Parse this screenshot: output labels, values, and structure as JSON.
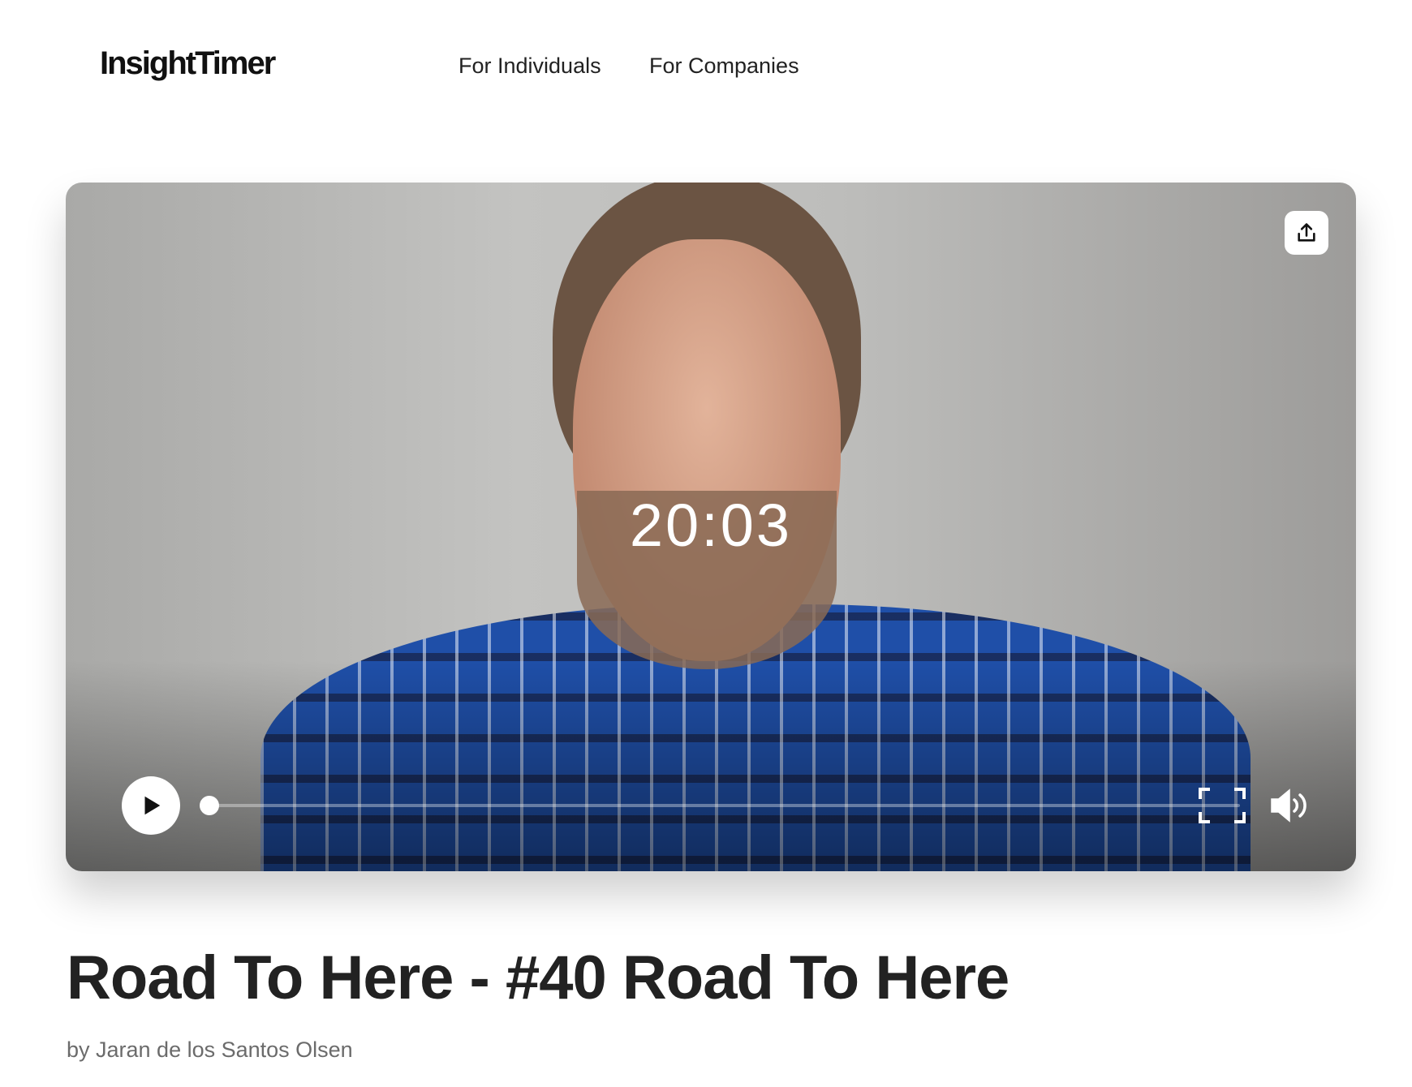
{
  "header": {
    "logo": "InsightTimer",
    "nav": [
      {
        "label": "For Individuals"
      },
      {
        "label": "For Companies"
      }
    ]
  },
  "player": {
    "time": "20:03",
    "progress": 0,
    "icons": {
      "share": "share-icon",
      "play": "play-icon",
      "fullscreen": "fullscreen-icon",
      "volume": "volume-icon"
    }
  },
  "track": {
    "title": "Road To Here - #40 Road To Here",
    "byline": "by Jaran de los Santos Olsen"
  }
}
